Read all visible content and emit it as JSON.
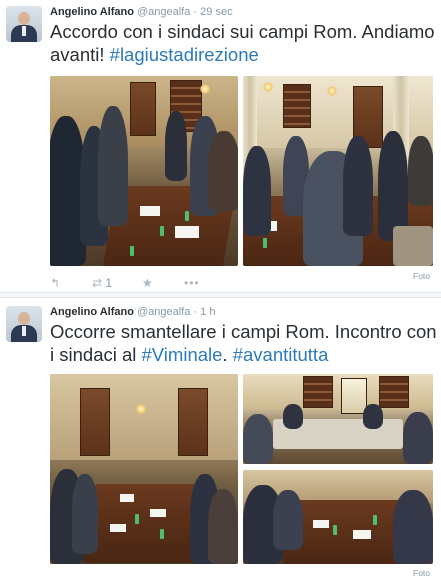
{
  "tweets": [
    {
      "author": "Angelino Alfano",
      "handle": "@angealfa",
      "separator": "·",
      "time": "29 sec",
      "text_plain": "Accordo con i sindaci sui campi Rom. Andiamo avanti! ",
      "hashtag": "#lagiustadirezione",
      "reply_icon": "reply-icon",
      "retweet_icon": "retweet-icon",
      "retweet_count": "1",
      "favorite_icon": "star-icon",
      "more_icon": "more-icon",
      "media_label": "Foto"
    },
    {
      "author": "Angelino Alfano",
      "handle": "@angealfa",
      "separator": "·",
      "time": "1 h",
      "text_plain": "Occorre smantellare i campi Rom. Incontro con i sindaci al ",
      "hashtag1": "#Viminale",
      "text_mid": ". ",
      "hashtag2": "#avantitutta",
      "media_label": "Foto"
    }
  ],
  "colors": {
    "link": "#2b7bb9",
    "meta": "#8899a6",
    "text": "#292f33"
  }
}
